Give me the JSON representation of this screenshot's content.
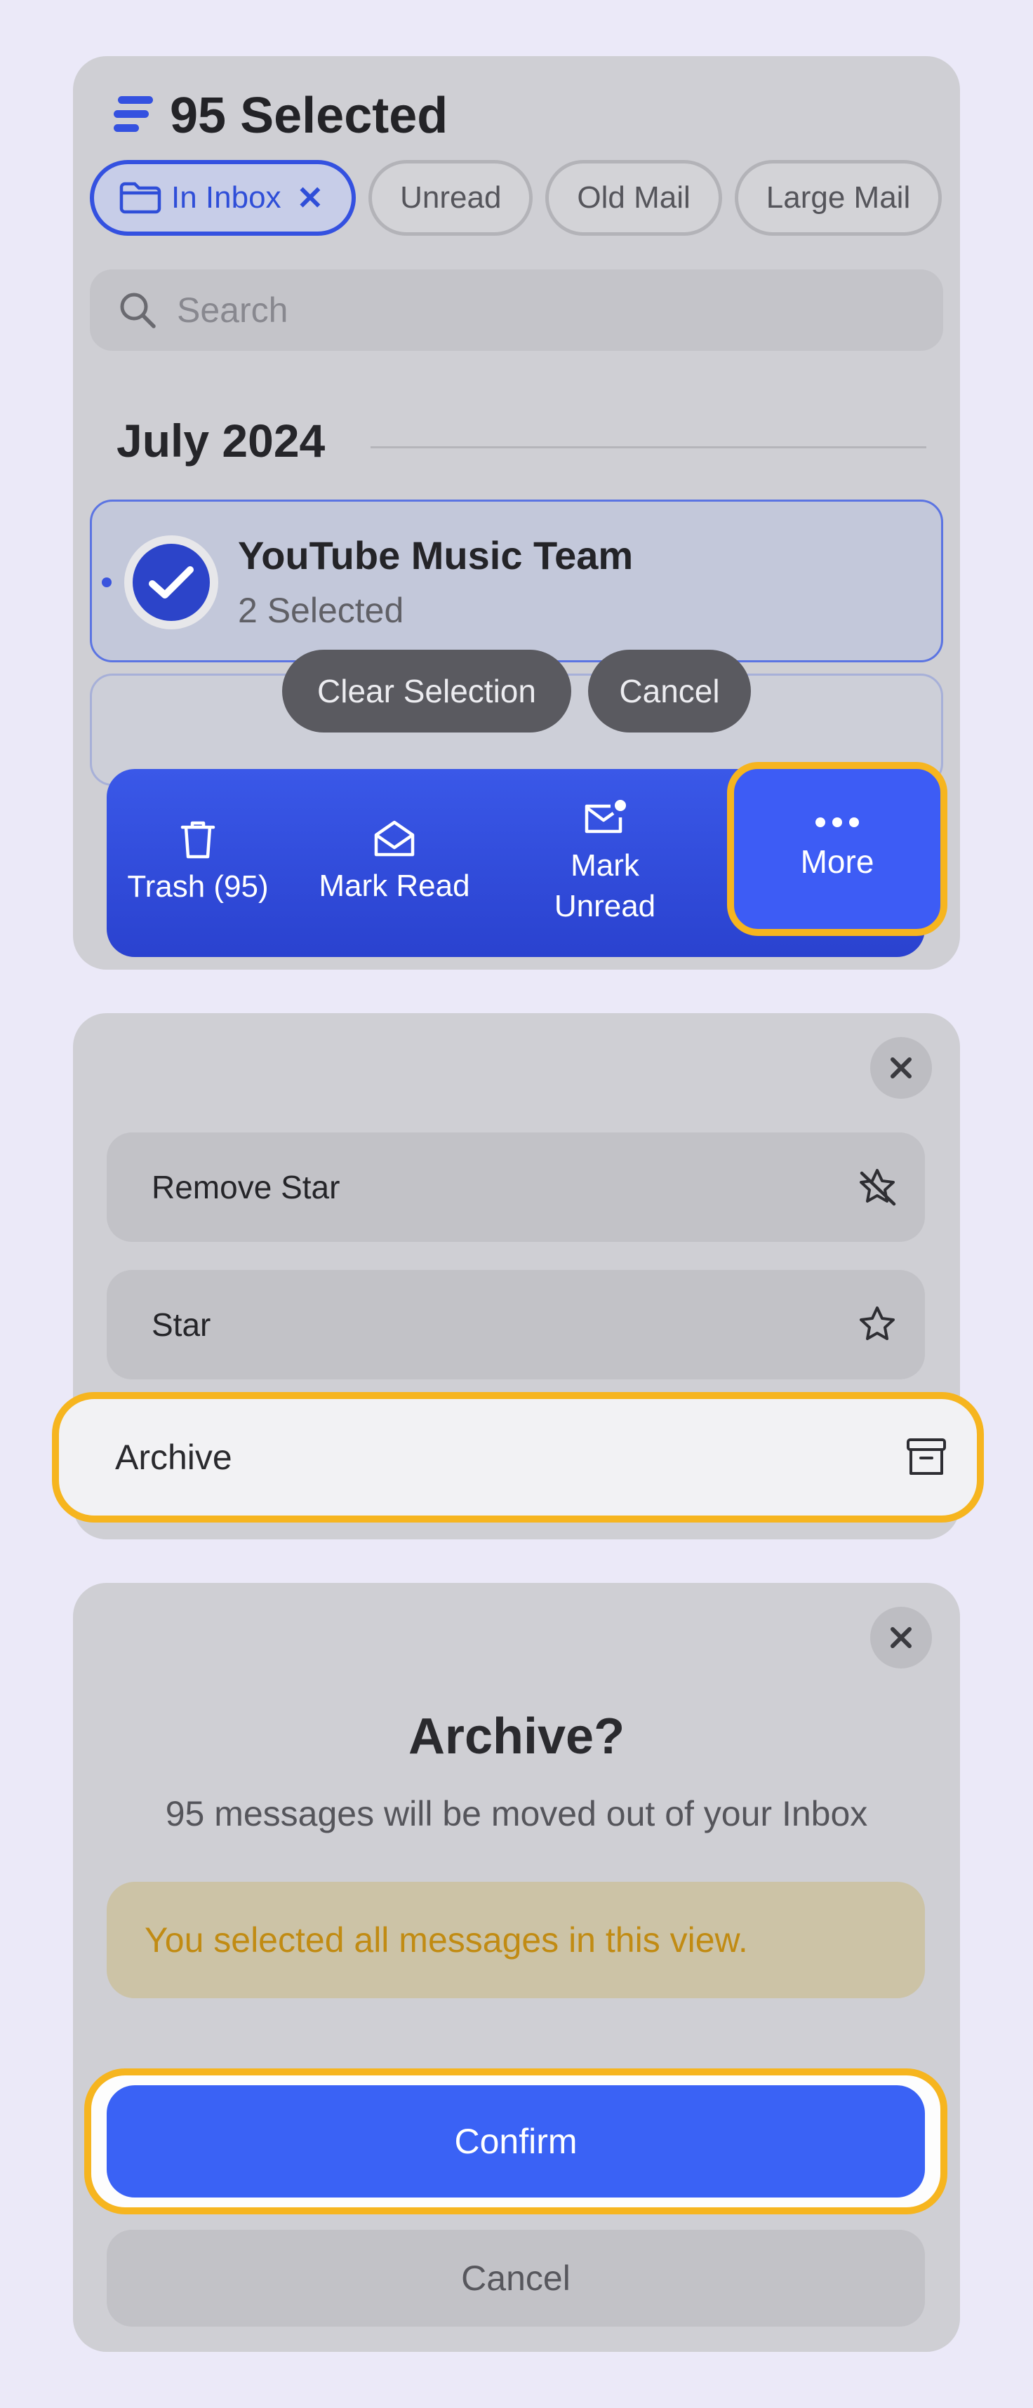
{
  "header": {
    "title": "95 Selected",
    "menu_icon": "list-icon"
  },
  "filters": [
    {
      "label": "In Inbox",
      "active": true,
      "icon": "folder-icon"
    },
    {
      "label": "Unread",
      "active": false
    },
    {
      "label": "Old Mail",
      "active": false
    },
    {
      "label": "Large Mail",
      "active": false
    }
  ],
  "search": {
    "placeholder": "Search"
  },
  "section": {
    "month": "July 2024"
  },
  "rows": [
    {
      "sender": "YouTube Music Team",
      "subtitle": "2 Selected",
      "selected": true
    }
  ],
  "selection_pills": {
    "clear": "Clear Selection",
    "cancel": "Cancel"
  },
  "action_bar": {
    "trash": "Trash (95)",
    "mark_read": "Mark Read",
    "mark_unread_line1": "Mark",
    "mark_unread_line2": "Unread",
    "more": "More"
  },
  "more_menu": {
    "items": [
      {
        "label": "Remove Star",
        "icon": "star-off-icon"
      },
      {
        "label": "Star",
        "icon": "star-icon"
      },
      {
        "label": "Archive",
        "icon": "archive-icon",
        "highlighted": true
      }
    ]
  },
  "dialog": {
    "title": "Archive?",
    "message": "95 messages will be moved out of your Inbox",
    "warning": "You selected all messages in this view.",
    "confirm": "Confirm",
    "cancel": "Cancel"
  },
  "colors": {
    "accent": "#3a58e8",
    "highlight": "#f6b51f",
    "warning_text": "#c18b13"
  }
}
